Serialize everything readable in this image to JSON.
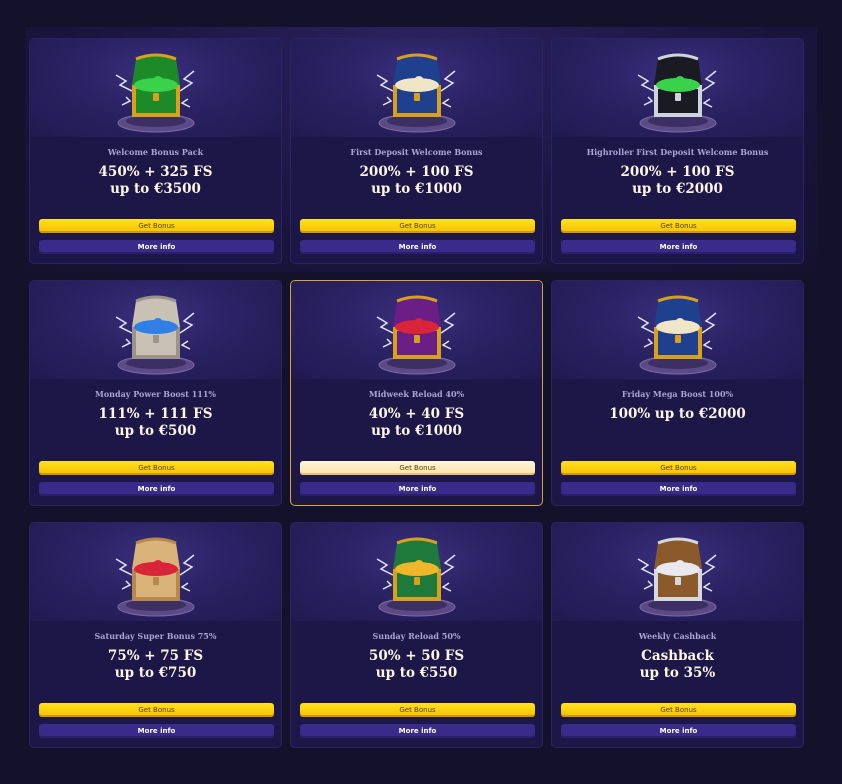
{
  "promotions": [
    {
      "name": "Welcome Bonus Pack",
      "offer_line1": "450% + 325 FS",
      "offer_line2": "up to €3500",
      "get_label": "Get Bonus",
      "more_label": "More info",
      "chest_icon": "chest-green-gold-icon",
      "body": "#1d8a2a",
      "trim": "#d9a01b",
      "gems": "#3ad24a"
    },
    {
      "name": "First Deposit Welcome Bonus",
      "offer_line1": "200% + 100 FS",
      "offer_line2": "up to €1000",
      "get_label": "Get Bonus",
      "more_label": "More info",
      "chest_icon": "chest-blue-gold-icon",
      "body": "#1f3f8f",
      "trim": "#d9a01b",
      "gems": "#efe6c8"
    },
    {
      "name": "Highroller First Deposit Welcome Bonus",
      "offer_line1": "200% + 100 FS",
      "offer_line2": "up to €2000",
      "get_label": "Get Bonus",
      "more_label": "More info",
      "chest_icon": "chest-black-silver-icon",
      "body": "#1a1a22",
      "trim": "#cfd3dc",
      "gems": "#3ad24a"
    },
    {
      "name": "Monday Power Boost 111%",
      "offer_line1": "111% + 111 FS",
      "offer_line2": "up to €500",
      "get_label": "Get Bonus",
      "more_label": "More info",
      "chest_icon": "chest-grey-blue-icon",
      "body": "#c9c2b4",
      "trim": "#9a948a",
      "gems": "#2f7fe6"
    },
    {
      "name": "Midweek Reload 40%",
      "offer_line1": "40% + 40 FS",
      "offer_line2": "up to €1000",
      "get_label": "Get Bonus",
      "more_label": "More info",
      "chest_icon": "chest-purple-gold-icon",
      "body": "#6a1e86",
      "trim": "#d9a01b",
      "gems": "#d8253a",
      "featured": true
    },
    {
      "name": "Friday Mega Boost 100%",
      "offer_line1": "100% up to €2000",
      "offer_line2": "",
      "get_label": "Get Bonus",
      "more_label": "More info",
      "chest_icon": "chest-blue-gold-icon",
      "body": "#1f3f8f",
      "trim": "#d9a01b",
      "gems": "#efe6c8"
    },
    {
      "name": "Saturday Super Bonus 75%",
      "offer_line1": "75% + 75 FS",
      "offer_line2": "up to €750",
      "get_label": "Get Bonus",
      "more_label": "More info",
      "chest_icon": "chest-tan-red-icon",
      "body": "#d9b37a",
      "trim": "#b8874a",
      "gems": "#d8253a"
    },
    {
      "name": "Sunday Reload 50%",
      "offer_line1": "50% + 50 FS",
      "offer_line2": "up to €550",
      "get_label": "Get Bonus",
      "more_label": "More info",
      "chest_icon": "chest-green-gold-icon",
      "body": "#1d7a3a",
      "trim": "#d9a01b",
      "gems": "#f0b62a"
    },
    {
      "name": "Weekly Cashback",
      "offer_line1": "Cashback",
      "offer_line2": "up to 35%",
      "get_label": "Get Bonus",
      "more_label": "More info",
      "chest_icon": "chest-brown-silver-icon",
      "body": "#8a5a2a",
      "trim": "#d6d8e0",
      "gems": "#e8e8ee"
    }
  ]
}
